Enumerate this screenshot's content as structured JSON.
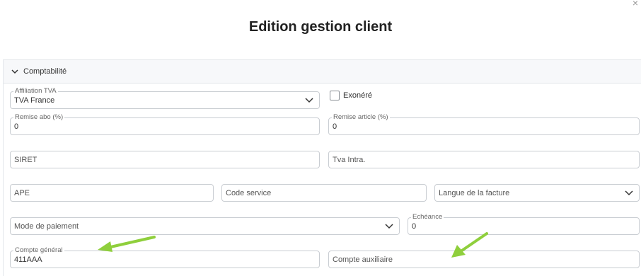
{
  "dialog": {
    "title": "Edition gestion client",
    "close_glyph": "×"
  },
  "section": {
    "label": "Comptabilité",
    "icon": "chevron-down-icon"
  },
  "fields": {
    "affiliation_tva": {
      "label": "Affiliation TVA",
      "value": "TVA France"
    },
    "exonere": {
      "label": "Exonéré",
      "checked": false
    },
    "remise_abo": {
      "label": "Remise abo (%)",
      "value": "0"
    },
    "remise_article": {
      "label": "Remise article (%)",
      "value": "0"
    },
    "siret": {
      "placeholder": "SIRET"
    },
    "tva_intra": {
      "placeholder": "Tva Intra."
    },
    "ape": {
      "placeholder": "APE"
    },
    "code_service": {
      "placeholder": "Code service"
    },
    "langue_facture": {
      "placeholder": "Langue de la facture"
    },
    "mode_paiement": {
      "placeholder": "Mode de paiement"
    },
    "echeance": {
      "label": "Echéance",
      "value": "0"
    },
    "compte_general": {
      "label": "Compte général",
      "value": "411AAA"
    },
    "compte_auxiliaire": {
      "placeholder": "Compte auxiliaire"
    }
  },
  "annotations": {
    "arrow_color": "#8fcf3c"
  }
}
